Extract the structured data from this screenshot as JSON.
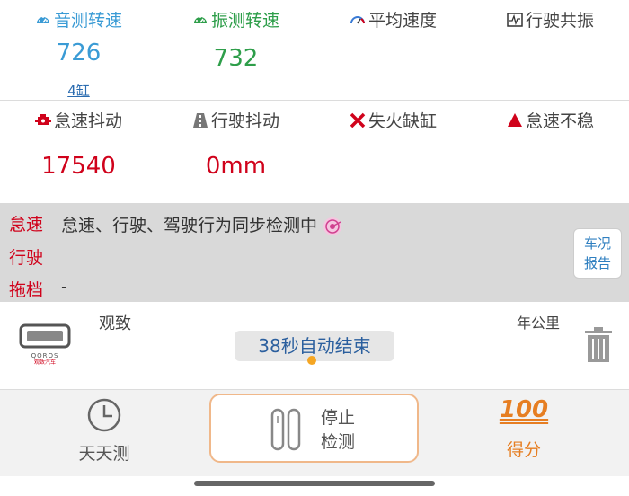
{
  "metrics_row1": [
    {
      "label": "音测转速",
      "value": "726",
      "sub": "4缸",
      "label_color": "#3a9bd5",
      "value_color": "#3a9bd5",
      "icon": "speedometer-icon"
    },
    {
      "label": "振测转速",
      "value": "732",
      "sub": "",
      "label_color": "#2e9e4a",
      "value_color": "#2e9e4a",
      "icon": "speedometer-icon"
    },
    {
      "label": "平均速度",
      "value": "",
      "sub": "",
      "label_color": "#444444",
      "value_color": "#444444",
      "icon": "gauge-icon"
    },
    {
      "label": "行驶共振",
      "value": "",
      "sub": "",
      "label_color": "#444444",
      "value_color": "#444444",
      "icon": "waveform-icon"
    }
  ],
  "metrics_row2": [
    {
      "label": "怠速抖动",
      "value": "17540",
      "label_color": "#444444",
      "value_color": "#d0021b",
      "icon": "engine-icon"
    },
    {
      "label": "行驶抖动",
      "value": "0mm",
      "label_color": "#444444",
      "value_color": "#d0021b",
      "icon": "road-icon"
    },
    {
      "label": "失火缺缸",
      "value": "",
      "label_color": "#444444",
      "value_color": "#d0021b",
      "icon": "cross-icon"
    },
    {
      "label": "怠速不稳",
      "value": "",
      "label_color": "#444444",
      "value_color": "#d0021b",
      "icon": "warning-triangle-icon"
    }
  ],
  "status": {
    "rows": [
      {
        "label": "怠速",
        "text": "怠速、行驶、驾驶行为同步检测中"
      },
      {
        "label": "行驶",
        "text": ""
      },
      {
        "label": "拖档",
        "text": "-"
      }
    ],
    "report_button": [
      "车况",
      "报告"
    ]
  },
  "car": {
    "brand": "观致",
    "logo_text": "QOROS",
    "logo_sub": "观致汽车",
    "mileage_label": "年公里",
    "countdown": "38秒自动结束"
  },
  "bottom": {
    "daily_label": "天天测",
    "stop_label": [
      "停止",
      "检测"
    ],
    "score_value": "100",
    "score_label": "得分"
  },
  "colors": {
    "accent_orange": "#e67e22",
    "red": "#d0021b",
    "blue": "#3a9bd5",
    "green": "#2e9e4a"
  }
}
